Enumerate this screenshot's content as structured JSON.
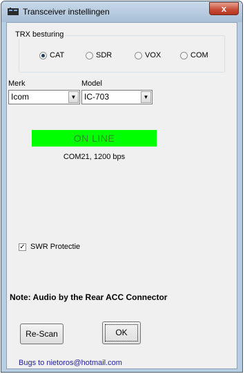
{
  "window": {
    "title": "Transceiver instellingen",
    "close_label": "x"
  },
  "trx": {
    "legend": "TRX besturing",
    "options": [
      {
        "label": "CAT",
        "checked": true
      },
      {
        "label": "SDR",
        "checked": false
      },
      {
        "label": "VOX",
        "checked": false
      },
      {
        "label": "COM",
        "checked": false
      }
    ]
  },
  "brand": {
    "label": "Merk",
    "value": "Icom"
  },
  "model": {
    "label": "Model",
    "value": "IC-703"
  },
  "status": {
    "text": "ON LINE",
    "color": "#00ff00",
    "port": "COM21, 1200 bps"
  },
  "swr": {
    "label": "SWR Protectie",
    "checked": true
  },
  "note": "Note: Audio by the Rear ACC Connector",
  "buttons": {
    "rescan": "Re-Scan",
    "ok": "OK"
  },
  "footer": "Bugs to nietoros@hotmail.com"
}
